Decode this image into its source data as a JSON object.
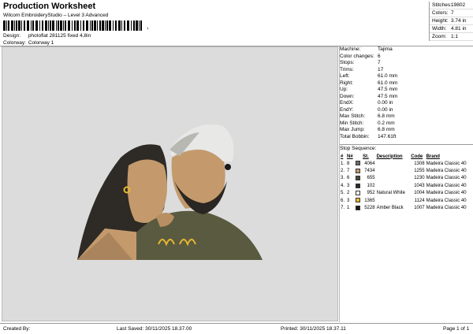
{
  "header": {
    "title": "Production Worksheet",
    "subtitle": "Wilcom EmbroideryStudio – Level 3 Advanced",
    "barcode_suffix": ","
  },
  "meta": {
    "design_label": "Design:",
    "design_value": "photoflat 281125 fixed 4,8in",
    "colorway_label": "Colorway:",
    "colorway_value": "Colorway 1"
  },
  "stats": [
    {
      "label": "Stitches:",
      "value": "19802"
    },
    {
      "label": "Colors:",
      "value": "7"
    },
    {
      "label": "Height:",
      "value": "3.74 in"
    },
    {
      "label": "Width:",
      "value": "4.81 in"
    },
    {
      "label": "Zoom:",
      "value": "1:1"
    }
  ],
  "machine": [
    {
      "label": "Machine:",
      "value": "Tajima"
    },
    {
      "label": "Color changes:",
      "value": "6"
    },
    {
      "label": "Stops:",
      "value": "7"
    },
    {
      "label": "Trims:",
      "value": "17"
    },
    {
      "label": "Left:",
      "value": "61.0 mm"
    },
    {
      "label": "Right:",
      "value": "61.0 mm"
    },
    {
      "label": "Up:",
      "value": "47.5 mm"
    },
    {
      "label": "Down:",
      "value": "47.5 mm"
    },
    {
      "label": "EndX:",
      "value": "0.00 in"
    },
    {
      "label": "EndY:",
      "value": "0.00 in"
    },
    {
      "label": "Max Stitch:",
      "value": "6.8 mm"
    },
    {
      "label": "Min Stitch:",
      "value": "0.2 mm"
    },
    {
      "label": "Max Jump:",
      "value": "6.8 mm"
    },
    {
      "label": "Total Bobbin:",
      "value": "147.61ft"
    }
  ],
  "sequence": {
    "title": "Stop Sequence:",
    "headers": [
      "#",
      "N#",
      "St.",
      "Description",
      "Code",
      "Brand"
    ],
    "rows": [
      {
        "num": "1.",
        "n": "8",
        "color": "#6b6b6b",
        "st": "4064",
        "desc": "",
        "code": "1308",
        "brand": "Madeira Classic 40"
      },
      {
        "num": "2.",
        "n": "7",
        "color": "#c49a6c",
        "st": "7434",
        "desc": "",
        "code": "1255",
        "brand": "Madeira Classic 40"
      },
      {
        "num": "3.",
        "n": "6",
        "color": "#4a4a3a",
        "st": "655",
        "desc": "",
        "code": "1230",
        "brand": "Madeira Classic 40"
      },
      {
        "num": "4.",
        "n": "3",
        "color": "#2a2a2a",
        "st": "102",
        "desc": "",
        "code": "1043",
        "brand": "Madeira Classic 40"
      },
      {
        "num": "5.",
        "n": "2",
        "color": "#ffffff",
        "st": "952",
        "desc": "Natural White",
        "code": "1004",
        "brand": "Madeira Classic 40"
      },
      {
        "num": "6.",
        "n": "3",
        "color": "#e6b830",
        "st": "1365",
        "desc": "",
        "code": "1124",
        "brand": "Madeira Classic 40"
      },
      {
        "num": "7.",
        "n": "1",
        "color": "#1a1a1a",
        "st": "5228",
        "desc": "Amber Black",
        "code": "1007",
        "brand": "Madeira Classic 40"
      }
    ]
  },
  "footer": {
    "created_by": "Created By:",
    "last_saved": "Last Saved: 30/11/2025 18.37.00",
    "printed": "Printed: 30/11/2025 18.37.11",
    "page": "Page 1 of 1"
  }
}
